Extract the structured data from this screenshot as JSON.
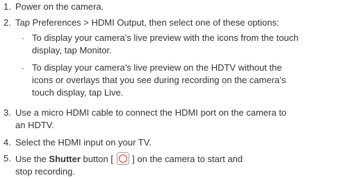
{
  "steps": [
    {
      "number": "1.",
      "lines": [
        "Power on the camera."
      ]
    },
    {
      "number": "2.",
      "lines": [
        "Tap Preferences > HDMI Output, then select one of these options:"
      ],
      "bullets": [
        {
          "marker": "·",
          "lines": [
            "To display your camera’s live preview with the icons from the touch",
            "display, tap Monitor."
          ]
        },
        {
          "marker": "·",
          "lines": [
            "To display your camera’s live preview on the HDTV without the",
            "icons or overlays that you see during recording on the camera’s",
            "touch display, tap Live."
          ]
        }
      ]
    },
    {
      "number": "3.",
      "lines": [
        "Use a micro HDMI cable to connect the HDMI port on the camera to",
        "an HDTV."
      ]
    },
    {
      "number": "4.",
      "lines": [
        "Select the HDMI input on your TV."
      ]
    },
    {
      "number": "5.",
      "line1_prefix": "Use the ",
      "line1_bold": "Shutter",
      "line1_mid": " button [",
      "line1_suffix": "] on the camera to start and",
      "line2": "stop recording.",
      "icon": "shutter-button-icon",
      "icon_color": "#e0312b"
    }
  ]
}
